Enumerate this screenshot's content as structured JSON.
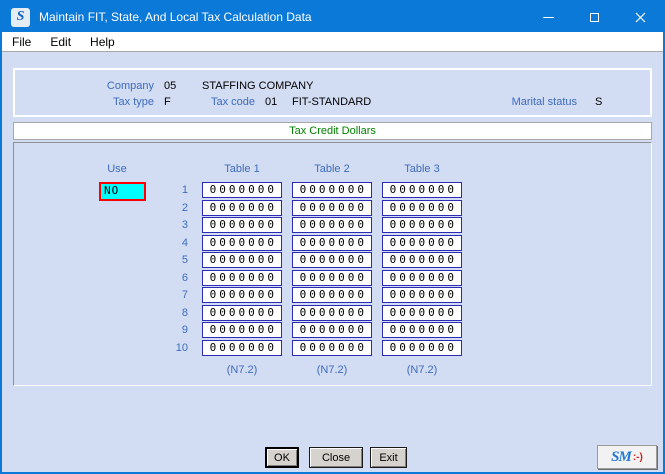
{
  "window": {
    "title": "Maintain FIT, State, And Local Tax Calculation Data",
    "icon_letter": "S"
  },
  "menu": {
    "items": [
      {
        "label": "File"
      },
      {
        "label": "Edit"
      },
      {
        "label": "Help"
      }
    ]
  },
  "header": {
    "company_label": "Company",
    "company_code": "05",
    "company_name": "STAFFING COMPANY",
    "tax_type_label": "Tax type",
    "tax_type": "F",
    "tax_code_label": "Tax code",
    "tax_code": "01",
    "tax_code_name": "FIT-STANDARD",
    "marital_status_label": "Marital status",
    "marital_status": "S"
  },
  "section": {
    "title": "Tax Credit Dollars"
  },
  "table": {
    "use_label": "Use",
    "use_value": "NO",
    "columns": [
      "Table 1",
      "Table 2",
      "Table 3"
    ],
    "rows": [
      {
        "num": "1",
        "t1": "0000000",
        "t2": "0000000",
        "t3": "0000000"
      },
      {
        "num": "2",
        "t1": "0000000",
        "t2": "0000000",
        "t3": "0000000"
      },
      {
        "num": "3",
        "t1": "0000000",
        "t2": "0000000",
        "t3": "0000000"
      },
      {
        "num": "4",
        "t1": "0000000",
        "t2": "0000000",
        "t3": "0000000"
      },
      {
        "num": "5",
        "t1": "0000000",
        "t2": "0000000",
        "t3": "0000000"
      },
      {
        "num": "6",
        "t1": "0000000",
        "t2": "0000000",
        "t3": "0000000"
      },
      {
        "num": "7",
        "t1": "0000000",
        "t2": "0000000",
        "t3": "0000000"
      },
      {
        "num": "8",
        "t1": "0000000",
        "t2": "0000000",
        "t3": "0000000"
      },
      {
        "num": "9",
        "t1": "0000000",
        "t2": "0000000",
        "t3": "0000000"
      },
      {
        "num": "10",
        "t1": "0000000",
        "t2": "0000000",
        "t3": "0000000"
      }
    ],
    "format_labels": [
      "(N7.2)",
      "(N7.2)",
      "(N7.2)"
    ]
  },
  "buttons": {
    "ok": "OK",
    "close": "Close",
    "exit": "Exit"
  },
  "logo": {
    "text": "SM",
    "smiley": ":-)"
  },
  "colors": {
    "titlebar": "#0b79d7",
    "background": "#d2dcf2",
    "field_border": "#2b2bb4",
    "label_blue": "#3e6cbe",
    "section_green": "#008000",
    "use_background": "#00ffff",
    "use_border": "#ff0000"
  }
}
